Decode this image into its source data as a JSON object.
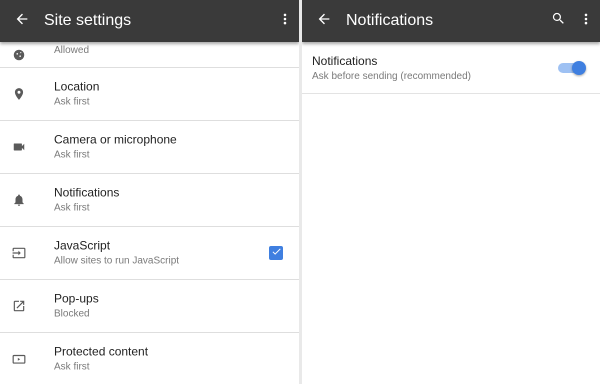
{
  "left": {
    "header": {
      "title": "Site settings",
      "back_icon": "arrow-left-icon",
      "menu_icon": "more-vert-icon"
    },
    "rows": [
      {
        "key": "cookies",
        "icon": "cookie-icon",
        "title": "",
        "subtitle": "Allowed"
      },
      {
        "key": "location",
        "icon": "location-pin-icon",
        "title": "Location",
        "subtitle": "Ask first"
      },
      {
        "key": "camera",
        "icon": "videocam-icon",
        "title": "Camera or microphone",
        "subtitle": "Ask first"
      },
      {
        "key": "notifications",
        "icon": "bell-icon",
        "title": "Notifications",
        "subtitle": "Ask first"
      },
      {
        "key": "javascript",
        "icon": "input-icon",
        "title": "JavaScript",
        "subtitle": "Allow sites to run JavaScript",
        "checked": true
      },
      {
        "key": "popups",
        "icon": "open-in-new-icon",
        "title": "Pop-ups",
        "subtitle": "Blocked"
      },
      {
        "key": "protected",
        "icon": "protected-content-icon",
        "title": "Protected content",
        "subtitle": "Ask first"
      }
    ]
  },
  "right": {
    "header": {
      "title": "Notifications",
      "back_icon": "arrow-left-icon",
      "search_icon": "search-icon",
      "menu_icon": "more-vert-icon"
    },
    "setting": {
      "title": "Notifications",
      "subtitle": "Ask before sending (recommended)",
      "enabled": true
    }
  },
  "colors": {
    "appbar": "#3a3a3a",
    "accent": "#3f7fe0",
    "accent_light": "#9ec1f3",
    "divider": "#dedede"
  }
}
